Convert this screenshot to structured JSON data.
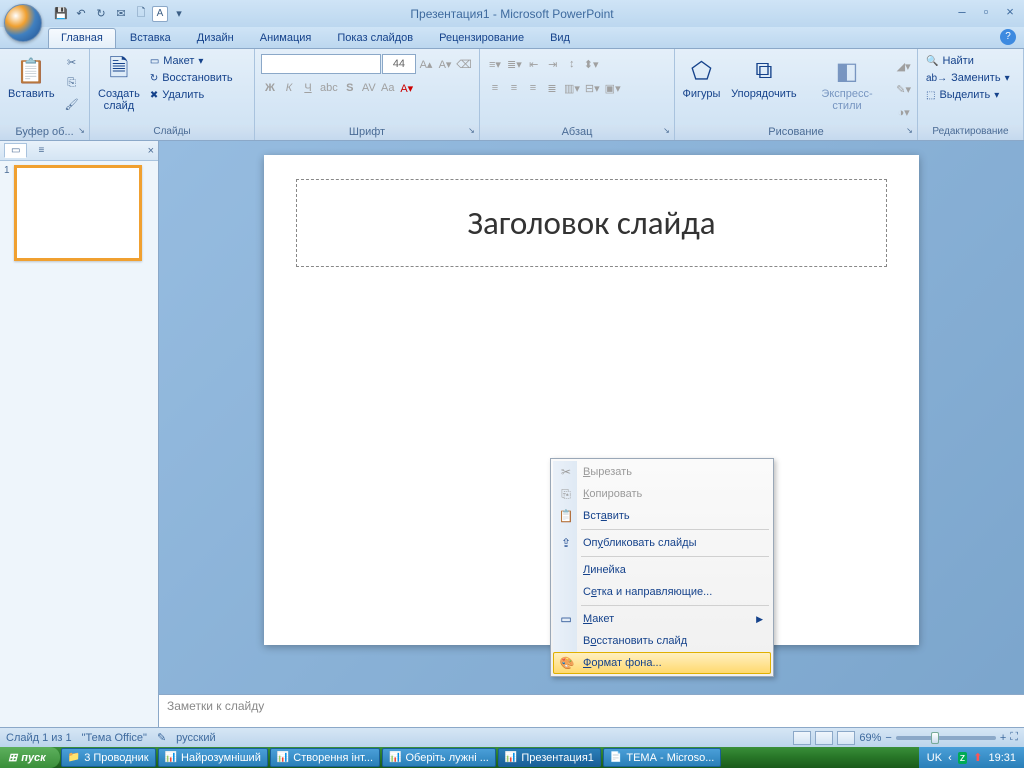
{
  "title": "Презентация1 - Microsoft PowerPoint",
  "qat": {
    "save": "💾",
    "undo": "↶",
    "redo": "↻",
    "mail": "✉",
    "new": "🗋",
    "a": "A"
  },
  "tabs": [
    "Главная",
    "Вставка",
    "Дизайн",
    "Анимация",
    "Показ слайдов",
    "Рецензирование",
    "Вид"
  ],
  "ribbon": {
    "clipboard": {
      "paste": "Вставить",
      "label": "Буфер об..."
    },
    "slides": {
      "new": "Создать\nслайд",
      "layout": "Макет",
      "reset": "Восстановить",
      "delete": "Удалить",
      "label": "Слайды"
    },
    "font": {
      "size": "44",
      "label": "Шрифт"
    },
    "para": {
      "label": "Абзац"
    },
    "draw": {
      "shapes": "Фигуры",
      "arrange": "Упорядочить",
      "styles": "Экспресс-стили",
      "label": "Рисование"
    },
    "edit": {
      "find": "Найти",
      "replace": "Заменить",
      "select": "Выделить",
      "label": "Редактирование"
    }
  },
  "slide": {
    "title_placeholder": "Заголовок слайда",
    "notes_placeholder": "Заметки к слайду"
  },
  "thumb": {
    "num": "1"
  },
  "ctx": {
    "cut": "Вырезать",
    "copy": "Копировать",
    "paste": "Вставить",
    "publish": "Опубликовать слайды",
    "ruler": "Линейка",
    "grid": "Сетка и направляющие...",
    "layout": "Макет",
    "reset": "Восстановить слайд",
    "format": "Формат фона..."
  },
  "status": {
    "slide": "Слайд 1 из 1",
    "theme": "\"Тема Office\"",
    "lang": "русский",
    "zoom": "69%"
  },
  "taskbar": {
    "start": "пуск",
    "items": [
      "3 Проводник",
      "Найрозумніший",
      "Створення інт...",
      "Оберіть лужні ...",
      "Презентация1",
      "ТЕМА - Microso..."
    ],
    "lang": "UK",
    "time": "19:31"
  }
}
